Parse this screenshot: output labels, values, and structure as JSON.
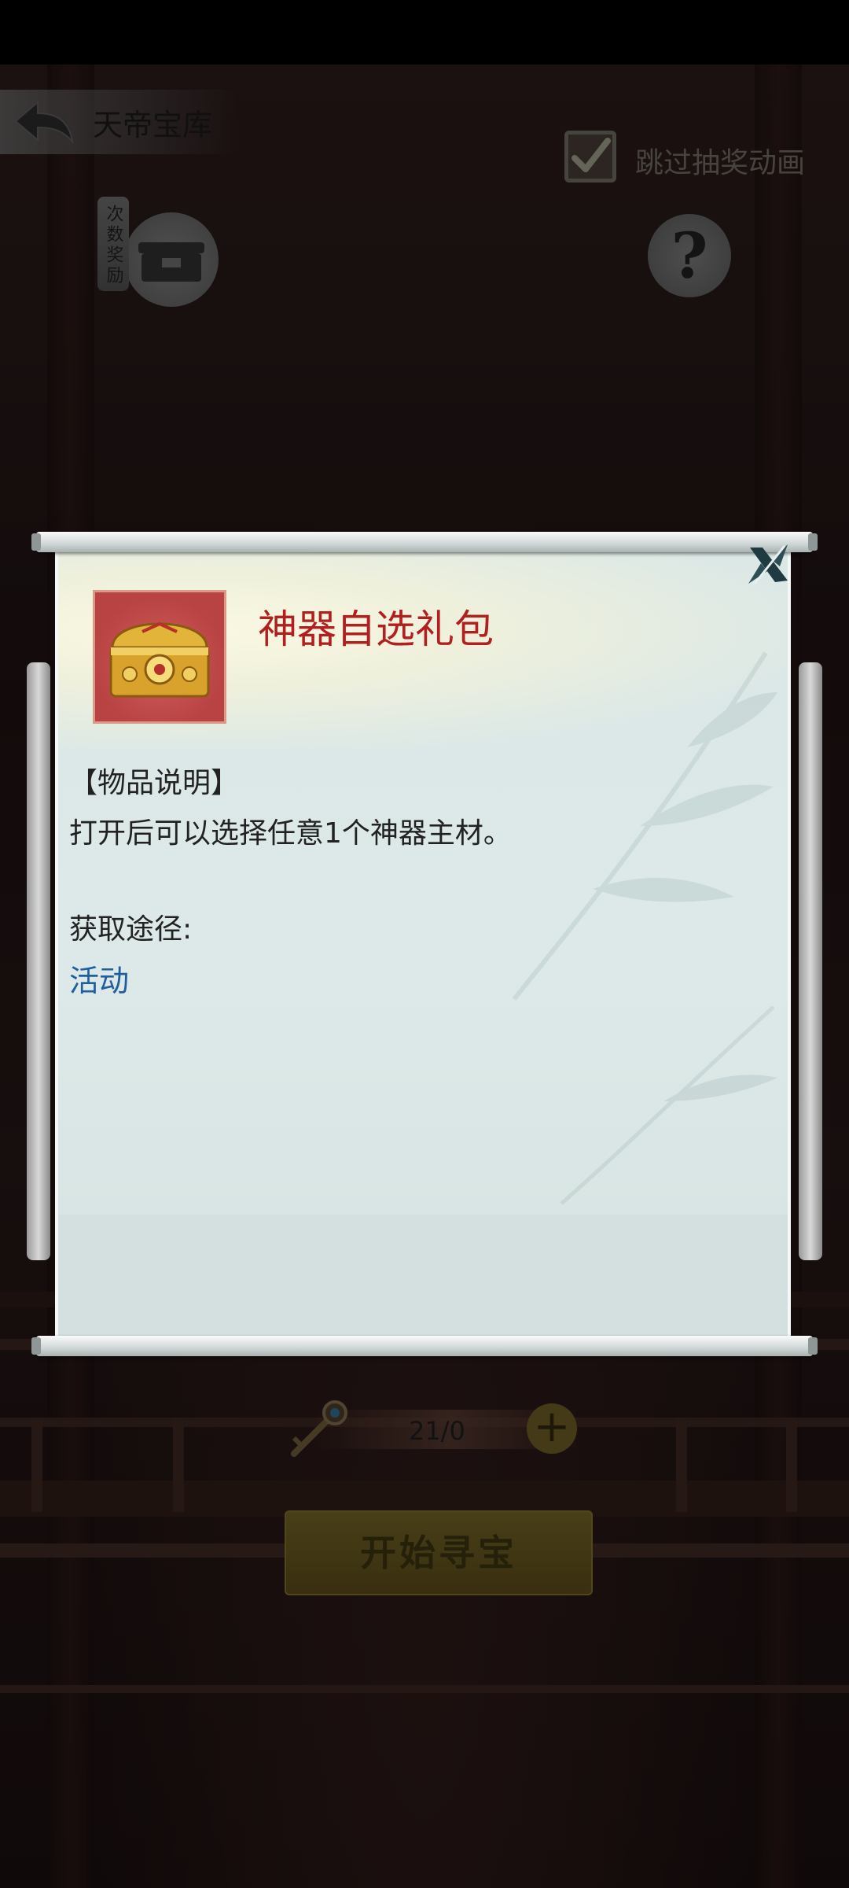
{
  "header": {
    "title": "天帝宝库",
    "skip_animation_label": "跳过抽奖动画",
    "skip_animation_checked": true
  },
  "buttons": {
    "count_reward_label": "次数奖励",
    "help_symbol": "?"
  },
  "bottom": {
    "key_count": "21/0",
    "plus_symbol": "+",
    "start_label": "开始寻宝"
  },
  "dialog": {
    "item_name": "神器自选礼包",
    "section_title": "【物品说明】",
    "description": "打开后可以选择任意1个神器主材。",
    "obtain_title": "获取途径:",
    "obtain_source": "活动",
    "close_icon": "close-icon"
  },
  "colors": {
    "item_name": "#b1201f",
    "link": "#1f5fa0",
    "panel": "#dce8e6"
  }
}
